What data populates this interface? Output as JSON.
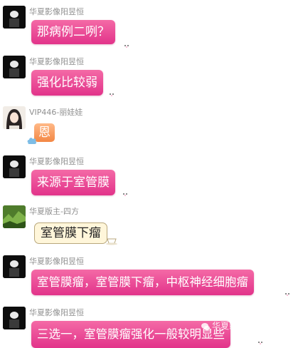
{
  "messages": [
    {
      "sender": "华夏影像阳昱恒",
      "text": "那病例二咧？"
    },
    {
      "sender": "华夏影像阳昱恒",
      "text": "强化比较弱"
    },
    {
      "sender": "VIP446-丽娃娃",
      "text": "恩"
    },
    {
      "sender": "华夏影像阳昱恒",
      "text": "来源于室管膜"
    },
    {
      "sender": "华夏版主-四方",
      "text": "室管膜下瘤"
    },
    {
      "sender": "华夏影像阳昱恒",
      "text": "室管膜瘤，室管膜下瘤，中枢神经细胞瘤"
    },
    {
      "sender": "华夏影像阳昱恒",
      "text": "三选一，室管膜瘤强化一般较明显些"
    }
  ],
  "watermark": "华夏影像诊断中心",
  "colors": {
    "pink_bubble": "#e8408f",
    "cream_bubble": "#fff6da",
    "orange_bubble": "#f58f4f"
  }
}
